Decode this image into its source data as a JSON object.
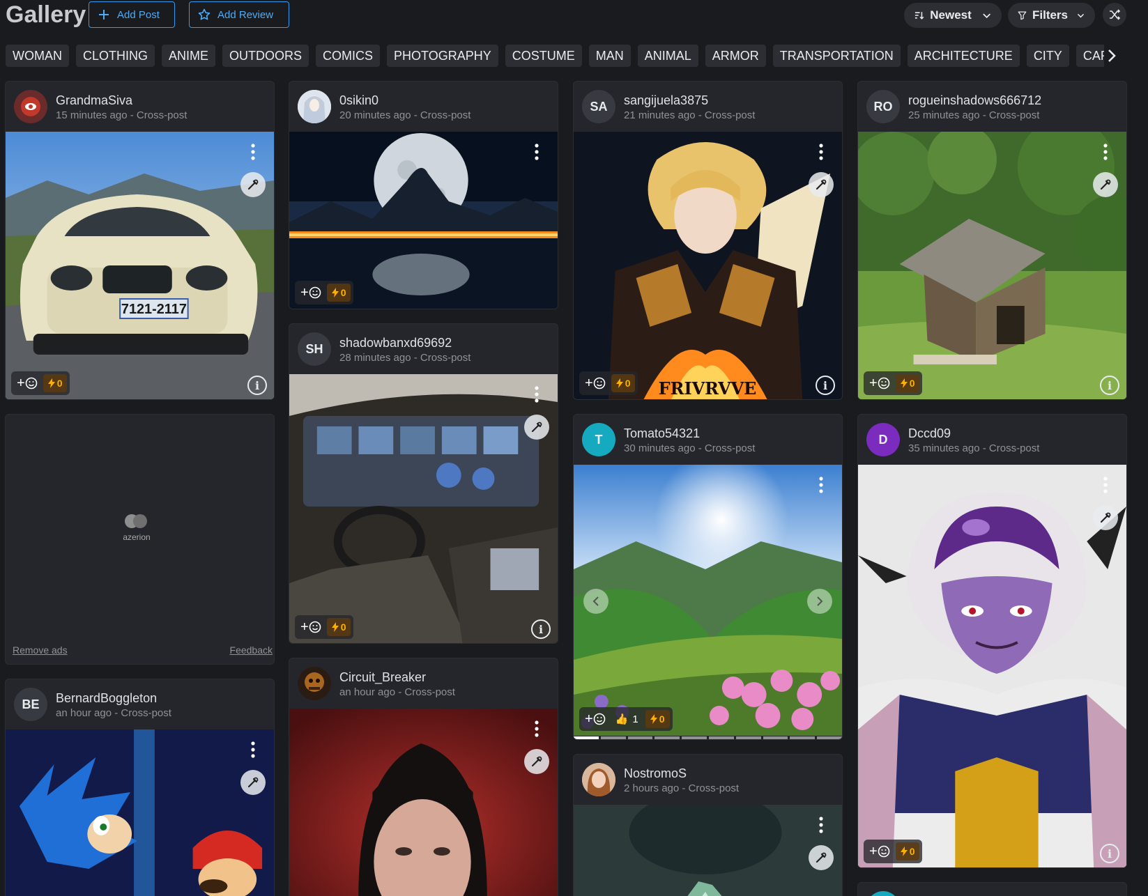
{
  "header": {
    "title": "Gallery",
    "add_post": "Add Post",
    "add_review": "Add Review",
    "sort": "Newest",
    "filters": "Filters"
  },
  "tags": [
    "WOMAN",
    "CLOTHING",
    "ANIME",
    "OUTDOORS",
    "COMICS",
    "PHOTOGRAPHY",
    "COSTUME",
    "MAN",
    "ANIMAL",
    "ARMOR",
    "TRANSPORTATION",
    "ARCHITECTURE",
    "CITY",
    "CARTOON"
  ],
  "cards": {
    "grandma": {
      "user": "GrandmaSiva",
      "meta": "15 minutes ago - Cross-post",
      "bolts": "0"
    },
    "osikin": {
      "user": "0sikin0",
      "meta": "20 minutes ago - Cross-post",
      "bolts": "0"
    },
    "sangij": {
      "user": "sangijuela3875",
      "initials": "SA",
      "meta": "21 minutes ago - Cross-post",
      "bolts": "0",
      "image_text": "FRIVRVVE"
    },
    "rogue": {
      "user": "rogueinshadows666712",
      "initials": "RO",
      "meta": "25 minutes ago - Cross-post",
      "bolts": "0"
    },
    "shadow": {
      "user": "shadowbanxd69692",
      "initials": "SH",
      "meta": "28 minutes ago - Cross-post",
      "bolts": "0"
    },
    "tomato": {
      "user": "Tomato54321",
      "initials": "T",
      "meta": "30 minutes ago - Cross-post",
      "likes": "1",
      "bolts": "0"
    },
    "dccd": {
      "user": "Dccd09",
      "initials": "D",
      "meta": "35 minutes ago - Cross-post",
      "bolts": "0"
    },
    "bernard": {
      "user": "BernardBoggleton",
      "initials": "BE",
      "meta": "an hour ago - Cross-post"
    },
    "circuit": {
      "user": "Circuit_Breaker",
      "meta": "an hour ago - Cross-post"
    },
    "nostromo": {
      "user": "NostromoS",
      "meta": "2 hours ago - Cross-post"
    }
  },
  "car_plate": "7121-2117",
  "ad": {
    "brand": "azerion",
    "remove": "Remove ads",
    "feedback": "Feedback"
  },
  "colors": {
    "accent": "#339af0",
    "bolt": "#fab005",
    "card": "#25262b",
    "background": "#1a1b1e"
  }
}
